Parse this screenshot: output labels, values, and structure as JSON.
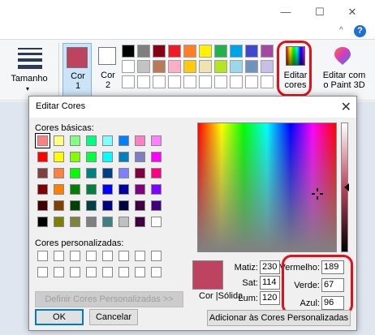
{
  "window": {
    "minimize_glyph": "—",
    "maximize_glyph": "☐",
    "close_glyph": "✕",
    "collapse_glyph": "^",
    "help_glyph": "?"
  },
  "ribbon": {
    "size_label": "Tamanho",
    "size_arrow": "▾",
    "color1": {
      "label_line1": "Cor",
      "label_line2": "1",
      "value": "#bd4360"
    },
    "color2": {
      "label_line1": "Cor",
      "label_line2": "2",
      "value": "#ffffff"
    },
    "palette_row1": [
      "#000000",
      "#7f7f7f",
      "#880015",
      "#ed1c24",
      "#ff7f27",
      "#fff200",
      "#22b14c",
      "#00a2e8",
      "#3f48cc",
      "#a349a4"
    ],
    "palette_row2": [
      "#ffffff",
      "#c3c3c3",
      "#b97a57",
      "#ffaec9",
      "#ffc90e",
      "#efe4b0",
      "#b5e61d",
      "#99d9ea",
      "#7092be",
      "#c8bfe7"
    ],
    "edit_colors": {
      "line1": "Editar",
      "line2": "cores",
      "icon": "color-spectrum-icon"
    },
    "paint3d": {
      "line1": "Editar com",
      "line2": "o Paint 3D",
      "icon": "paint3d-icon"
    },
    "highlight_color": "#e3101a"
  },
  "dialog": {
    "title": "Editar Cores",
    "close_glyph": "✕",
    "basic_colors_label": "Cores básicas:",
    "basic_colors": [
      [
        "#ff8080",
        "#ffff80",
        "#80ff80",
        "#00ff80",
        "#80ffff",
        "#0080ff",
        "#ff80c0",
        "#ff80ff"
      ],
      [
        "#ff0000",
        "#ffff00",
        "#80ff00",
        "#00ff40",
        "#00ffff",
        "#0080c0",
        "#8080c0",
        "#ff00ff"
      ],
      [
        "#804040",
        "#ff8040",
        "#00ff00",
        "#008080",
        "#004080",
        "#8080ff",
        "#800040",
        "#ff0080"
      ],
      [
        "#800000",
        "#ff8000",
        "#008000",
        "#008040",
        "#0000ff",
        "#0000a0",
        "#800080",
        "#8000ff"
      ],
      [
        "#400000",
        "#804000",
        "#004000",
        "#004040",
        "#000080",
        "#000040",
        "#400040",
        "#400080"
      ],
      [
        "#000000",
        "#808000",
        "#808040",
        "#808080",
        "#408080",
        "#c0c0c0",
        "#400040",
        "#ffffff"
      ]
    ],
    "custom_colors_label": "Cores personalizadas:",
    "define_custom_button": "Definir Cores Personalizadas >>",
    "ok_button": "OK",
    "cancel_button": "Cancelar",
    "preview_label": "Cor |Sólida",
    "preview_color": "#bd4360",
    "hue_label": "Matiz:",
    "hue_value": "230",
    "sat_label": "Sat:",
    "sat_value": "114",
    "lum_label": "Lum:",
    "lum_value": "120",
    "red_label": "Vermelho:",
    "red_value": "189",
    "green_label": "Verde:",
    "green_value": "67",
    "blue_label": "Azul:",
    "blue_value": "96",
    "add_custom_button": "Adicionar às Cores Personalizadas"
  }
}
